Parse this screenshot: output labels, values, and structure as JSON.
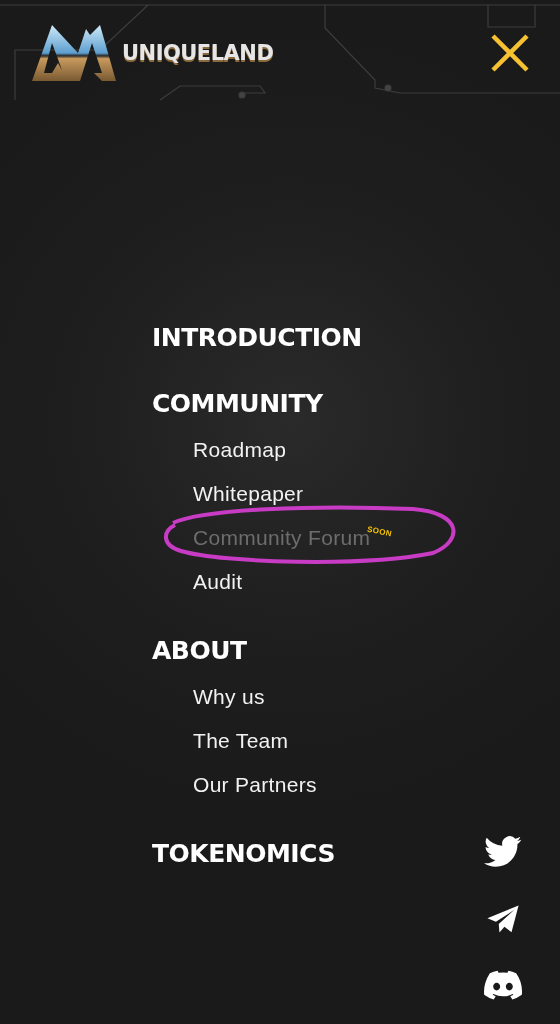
{
  "header": {
    "logo_text": "UNIQUELAND"
  },
  "menu": [
    {
      "kind": "heading",
      "label": "INTRODUCTION"
    },
    {
      "kind": "heading",
      "label": "COMMUNITY",
      "children": [
        {
          "label": "Roadmap",
          "disabled": false
        },
        {
          "label": "Whitepaper",
          "disabled": false
        },
        {
          "label": "Community Forum",
          "disabled": true,
          "badge": "SOON",
          "circled": true
        },
        {
          "label": "Audit",
          "disabled": false
        }
      ]
    },
    {
      "kind": "heading",
      "label": "ABOUT",
      "children": [
        {
          "label": "Why us",
          "disabled": false
        },
        {
          "label": "The Team",
          "disabled": false
        },
        {
          "label": "Our Partners",
          "disabled": false
        }
      ]
    },
    {
      "kind": "heading",
      "label": "TOKENOMICS"
    }
  ],
  "social": [
    {
      "kind": "twitter"
    },
    {
      "kind": "telegram"
    },
    {
      "kind": "discord"
    }
  ]
}
